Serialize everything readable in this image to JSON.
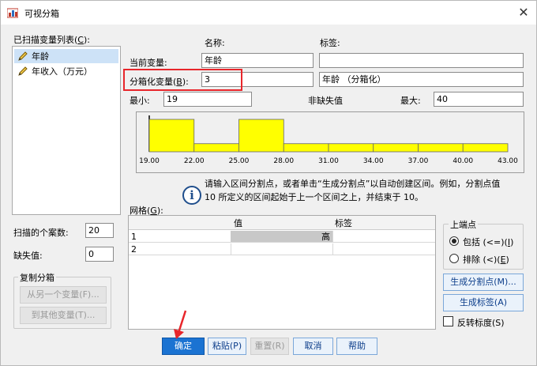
{
  "window": {
    "title": "可视分箱"
  },
  "scan_list": {
    "label": "已扫描变量列表(",
    "label_key": "C",
    "label_end": "):",
    "items": [
      {
        "label": "年龄",
        "selected": true
      },
      {
        "label": "年收入（万元）",
        "selected": false
      }
    ]
  },
  "headers": {
    "name": "名称:",
    "label": "标签:"
  },
  "current_var": {
    "label": "当前变量:",
    "name": "年龄",
    "var_label": ""
  },
  "binned_var": {
    "label": "分箱化变量(",
    "label_key": "B",
    "label_end": "):",
    "name": "3",
    "var_label": "年龄 （分箱化）"
  },
  "stats": {
    "min_label": "最小:",
    "min": "19",
    "nonmissing_label": "非缺失值",
    "max_label": "最大:",
    "max": "40"
  },
  "chart_data": {
    "type": "bar",
    "x_ticks": [
      "19.00",
      "22.00",
      "25.00",
      "28.00",
      "31.00",
      "34.00",
      "37.00",
      "40.00",
      "43.00"
    ],
    "bins": [
      {
        "from": 19,
        "to": 22,
        "value": 4
      },
      {
        "from": 22,
        "to": 25,
        "value": 1
      },
      {
        "from": 25,
        "to": 28,
        "value": 4
      },
      {
        "from": 28,
        "to": 31,
        "value": 1
      },
      {
        "from": 31,
        "to": 34,
        "value": 1
      },
      {
        "from": 34,
        "to": 37,
        "value": 1
      },
      {
        "from": 37,
        "to": 40,
        "value": 1
      },
      {
        "from": 40,
        "to": 43,
        "value": 1
      }
    ],
    "xlim": [
      19,
      43
    ],
    "ylim": [
      0,
      4
    ],
    "bar_color": "#ffff00"
  },
  "info": {
    "line1": "请输入区间分割点，或者单击“生成分割点”以自动创建区间。例如，分割点值",
    "line2": "10 所定义的区间起始于上一个区间之上，并结束于 10。"
  },
  "grid": {
    "label": "网格(",
    "label_key": "G",
    "label_end": "):",
    "columns": [
      "值",
      "标签"
    ],
    "rows": [
      {
        "num": "1",
        "value": "高",
        "label": ""
      },
      {
        "num": "2",
        "value": "",
        "label": ""
      }
    ]
  },
  "upper_endpoint": {
    "title": "上端点",
    "options": [
      {
        "label": "包括 (<=)(",
        "key": "I",
        "end": ")",
        "selected": true
      },
      {
        "label": "排除 (<)(",
        "key": "E",
        "end": ")",
        "selected": false
      }
    ]
  },
  "buttons": {
    "make_cutpoints": "生成分割点(M)...",
    "make_labels": "生成标签(A)",
    "reverse_label": "反转标度(S)",
    "from_other": "从另一个变量(F)...",
    "to_other": "到其他变量(T)...",
    "ok": "确定",
    "paste": "粘贴(P)",
    "reset": "重置(R)",
    "cancel": "取消",
    "help": "帮助"
  },
  "scan_cases": {
    "label": "扫描的个案数:",
    "value": "20"
  },
  "missing": {
    "label": "缺失值:",
    "value": "0"
  },
  "copy_bins": {
    "title": "复制分箱"
  },
  "annotation": {
    "arrow_color": "#e8262b"
  }
}
